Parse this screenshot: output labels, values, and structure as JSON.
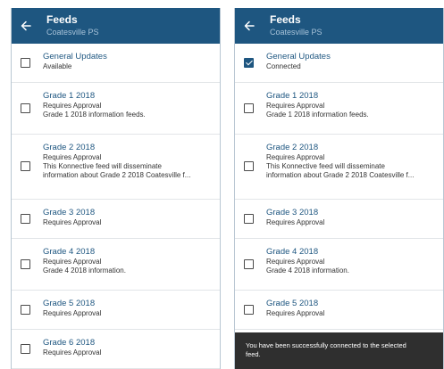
{
  "screens": [
    {
      "header": {
        "title": "Feeds",
        "subtitle": "Coatesville PS",
        "back_icon": "arrow-left-icon"
      },
      "colors": {
        "header_bg": "#1e5680",
        "link": "#1e5680"
      },
      "feeds": [
        {
          "name": "General Updates",
          "status": "Available",
          "checked": false,
          "desc": []
        },
        {
          "name": "Grade 1 2018",
          "status": "Requires Approval",
          "checked": false,
          "desc": [
            "Grade 1 2018 information feeds."
          ]
        },
        {
          "name": "Grade 2 2018",
          "status": "Requires Approval",
          "checked": false,
          "desc": [
            "This Konnective feed will disseminate",
            "information about Grade 2 2018 Coatesville f..."
          ]
        },
        {
          "name": "Grade 3 2018",
          "status": "Requires Approval",
          "checked": false,
          "desc": []
        },
        {
          "name": "Grade 4 2018",
          "status": "Requires Approval",
          "checked": false,
          "desc": [
            "Grade 4 2018 information."
          ]
        },
        {
          "name": "Grade 5 2018",
          "status": "Requires Approval",
          "checked": false,
          "desc": []
        },
        {
          "name": "Grade 6  2018",
          "status": "Requires Approval",
          "checked": false,
          "desc": []
        }
      ],
      "snackbar": null
    },
    {
      "header": {
        "title": "Feeds",
        "subtitle": "Coatesville PS",
        "back_icon": "arrow-left-icon"
      },
      "colors": {
        "header_bg": "#1e5680",
        "link": "#1e5680"
      },
      "feeds": [
        {
          "name": "General Updates",
          "status": "Connected",
          "checked": true,
          "desc": []
        },
        {
          "name": "Grade 1 2018",
          "status": "Requires Approval",
          "checked": false,
          "desc": [
            "Grade 1 2018 information feeds."
          ]
        },
        {
          "name": "Grade 2 2018",
          "status": "Requires Approval",
          "checked": false,
          "desc": [
            "This Konnective feed will disseminate",
            "information about Grade 2 2018 Coatesville f..."
          ]
        },
        {
          "name": "Grade 3 2018",
          "status": "Requires Approval",
          "checked": false,
          "desc": []
        },
        {
          "name": "Grade 4 2018",
          "status": "Requires Approval",
          "checked": false,
          "desc": [
            "Grade 4 2018 information."
          ]
        },
        {
          "name": "Grade 5 2018",
          "status": "Requires Approval",
          "checked": false,
          "desc": []
        }
      ],
      "snackbar": {
        "text": [
          "You have been successfully connected to the selected",
          "feed."
        ]
      }
    }
  ]
}
